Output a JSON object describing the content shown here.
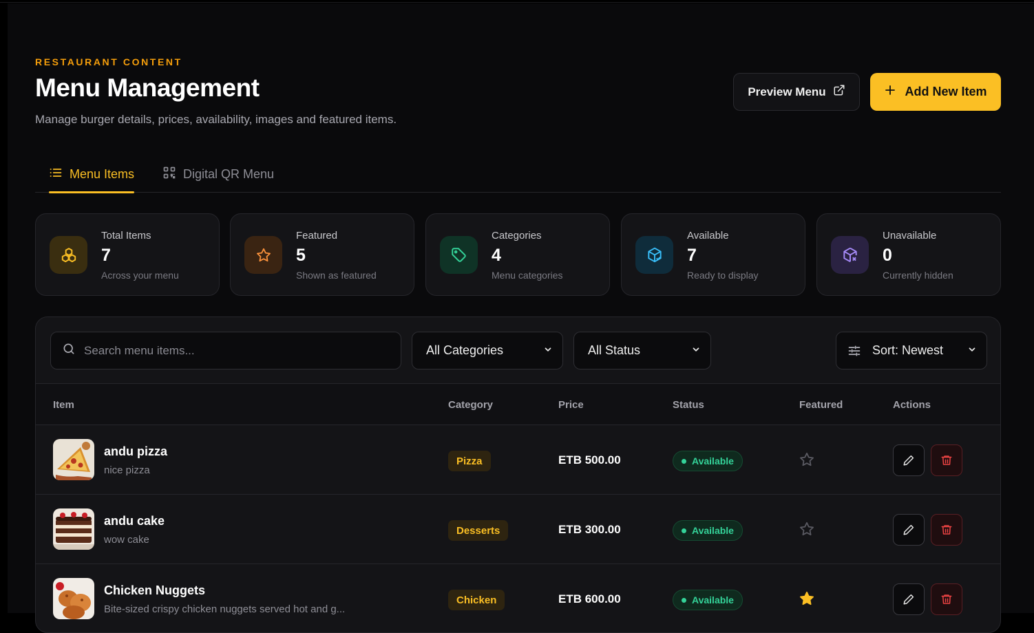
{
  "header": {
    "eyebrow": "RESTAURANT CONTENT",
    "title": "Menu Management",
    "subtitle": "Manage burger details, prices, availability, images and featured items.",
    "preview_label": "Preview Menu",
    "add_label": "Add New Item"
  },
  "tabs": [
    {
      "label": "Menu Items",
      "icon": "list-icon",
      "active": true
    },
    {
      "label": "Digital QR Menu",
      "icon": "qr-code-icon",
      "active": false
    }
  ],
  "stats": [
    {
      "label": "Total Items",
      "value": "7",
      "sub": "Across your menu",
      "icon": "boxes-icon",
      "color": "#fbbf24",
      "bg": "#3a2e10"
    },
    {
      "label": "Featured",
      "value": "5",
      "sub": "Shown as featured",
      "icon": "star-icon",
      "color": "#fb923c",
      "bg": "#3a2412"
    },
    {
      "label": "Categories",
      "value": "4",
      "sub": "Menu categories",
      "icon": "tag-icon",
      "color": "#34d399",
      "bg": "#0f3326"
    },
    {
      "label": "Available",
      "value": "7",
      "sub": "Ready to display",
      "icon": "package-check-icon",
      "color": "#38bdf8",
      "bg": "#0f2c3b"
    },
    {
      "label": "Unavailable",
      "value": "0",
      "sub": "Currently hidden",
      "icon": "package-x-icon",
      "color": "#a78bfa",
      "bg": "#2a2242"
    }
  ],
  "filters": {
    "search_placeholder": "Search menu items...",
    "category": "All Categories",
    "status": "All Status",
    "sort": "Sort: Newest"
  },
  "table": {
    "columns": [
      "Item",
      "Category",
      "Price",
      "Status",
      "Featured",
      "Actions"
    ],
    "rows": [
      {
        "name": "andu pizza",
        "desc": "nice pizza",
        "category": "Pizza",
        "price": "ETB 500.00",
        "status": "Available",
        "featured": false,
        "thumb": "pizza"
      },
      {
        "name": "andu cake",
        "desc": "wow cake",
        "category": "Desserts",
        "price": "ETB 300.00",
        "status": "Available",
        "featured": false,
        "thumb": "cake"
      },
      {
        "name": "Chicken Nuggets",
        "desc": "Bite-sized crispy chicken nuggets served hot and g...",
        "category": "Chicken",
        "price": "ETB 600.00",
        "status": "Available",
        "featured": true,
        "thumb": "chicken"
      }
    ]
  },
  "colors": {
    "accent": "#fbbf24",
    "available": "#34d399",
    "danger": "#ef4444"
  }
}
